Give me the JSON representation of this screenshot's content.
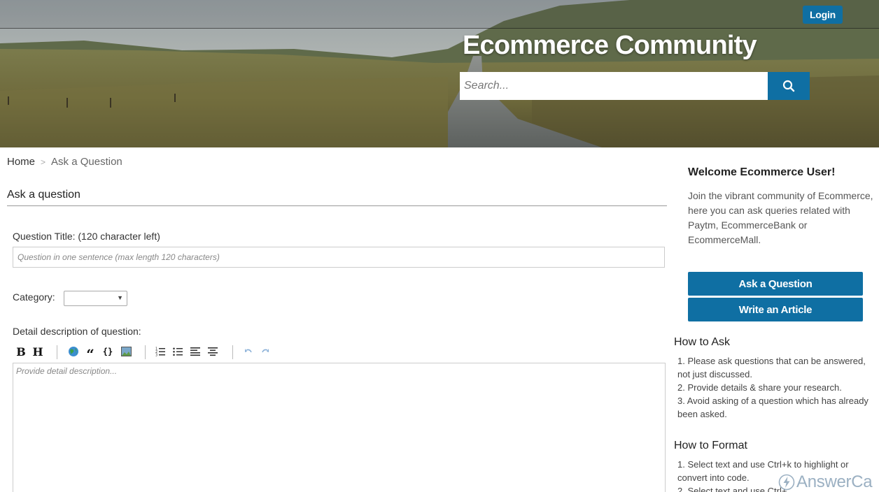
{
  "header": {
    "login_label": "Login",
    "site_title": "Ecommerce Community",
    "search_placeholder": "Search...",
    "search_icon": "search-icon"
  },
  "breadcrumb": {
    "home": "Home",
    "separator": ">",
    "current": "Ask a Question"
  },
  "form": {
    "section_title": "Ask a question",
    "title_label": "Question Title: (120 character left)",
    "title_placeholder": "Question in one sentence (max length 120 characters)",
    "category_label": "Category:",
    "category_value": "",
    "description_label": "Detail description of question:",
    "description_placeholder": "Provide detail description...",
    "toolbar": {
      "bold": "B",
      "heading": "H",
      "link_icon": "link-globe-icon",
      "quote": "“",
      "code": "{}",
      "image_icon": "image-icon",
      "ordered_list_icon": "ordered-list-icon",
      "unordered_list_icon": "unordered-list-icon",
      "align_icon": "align-left-icon",
      "center_icon": "align-center-icon",
      "undo_icon": "undo-icon",
      "redo_icon": "redo-icon"
    }
  },
  "sidebar": {
    "welcome_title": "Welcome Ecommerce User!",
    "welcome_text": "Join the vibrant community of Ecommerce, here you can ask queries related with Paytm, EcommerceBank or EcommerceMall.",
    "ask_button": "Ask a Question",
    "write_button": "Write an Article",
    "how_to_ask": {
      "title": "How to Ask",
      "items": [
        "1. Please ask questions that can be answered, not just discussed.",
        "2. Provide details & share your research.",
        "3. Avoid asking of a question which has already been asked."
      ]
    },
    "how_to_format": {
      "title": "How to Format",
      "items": [
        "1. Select text and use Ctrl+k to highlight or convert into code.",
        "2. Select text and use Ctrl+..."
      ]
    }
  },
  "footer": {
    "brand": "AnswerCa"
  },
  "colors": {
    "primary": "#0f6fa3",
    "text": "#333333",
    "muted": "#555555"
  }
}
